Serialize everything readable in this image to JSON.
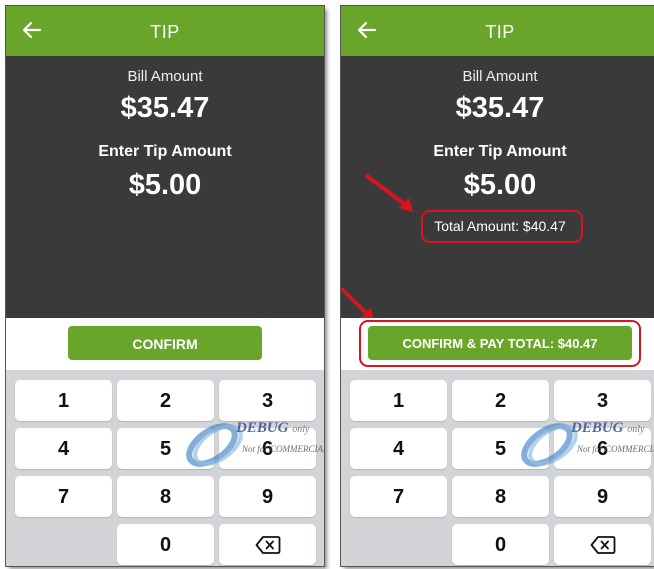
{
  "colors": {
    "accent": "#6aa52b",
    "dark": "#3a3a3a",
    "keypad_bg": "#d3d4d8",
    "annotation": "#d9141c"
  },
  "screen1": {
    "header": {
      "title": "TIP",
      "back_icon": "arrow-left-icon"
    },
    "bill_label": "Bill Amount",
    "bill_amount": "$35.47",
    "tip_label": "Enter Tip Amount",
    "tip_amount": "$5.00",
    "confirm_label": "CONFIRM"
  },
  "screen2": {
    "header": {
      "title": "TIP",
      "back_icon": "arrow-left-icon"
    },
    "bill_label": "Bill Amount",
    "bill_amount": "$35.47",
    "tip_label": "Enter Tip Amount",
    "tip_amount": "$5.00",
    "total_label": "Total Amount: $40.47",
    "confirm_label": "CONFIRM & PAY TOTAL: $40.47"
  },
  "keypad": {
    "keys": [
      "1",
      "2",
      "3",
      "4",
      "5",
      "6",
      "7",
      "8",
      "9",
      "0"
    ],
    "backspace_icon": "backspace-icon"
  },
  "watermark": {
    "title": "DEBUG",
    "title_suffix": "only",
    "subtitle": "Not for COMMERCIAL"
  }
}
